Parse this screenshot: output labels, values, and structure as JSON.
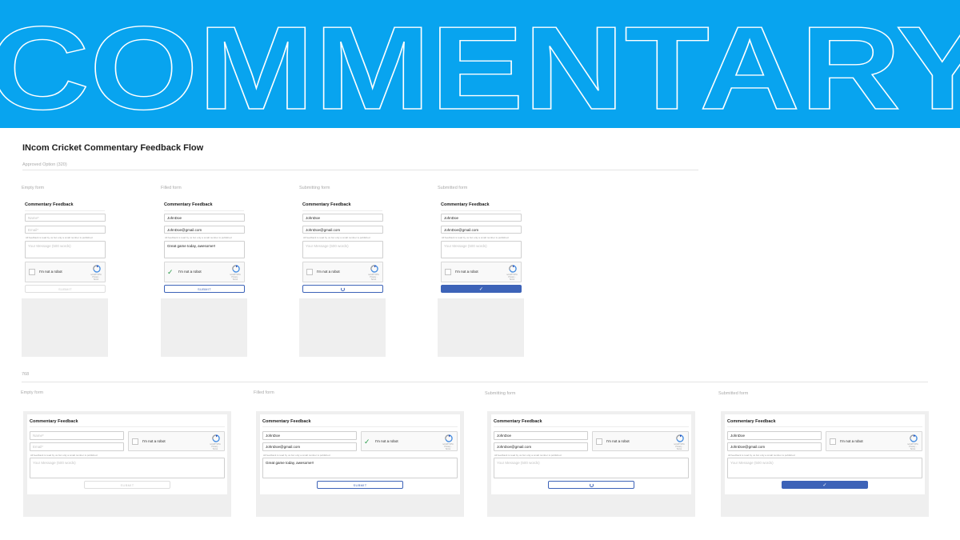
{
  "banner": {
    "text": "COMMENTARY",
    "color": "#08a4ef"
  },
  "page_title": "INcom Cricket Commentary Feedback Flow",
  "mobile_section": {
    "label": "Approved Option (320)",
    "frames": [
      {
        "label": "Empty form",
        "state": "empty"
      },
      {
        "label": "Filled form",
        "state": "filled"
      },
      {
        "label": "Submitting form",
        "state": "submitting"
      },
      {
        "label": "Submitted form",
        "state": "submitted"
      }
    ]
  },
  "tablet_section": {
    "label": "768",
    "frames": [
      {
        "label": "Empty form",
        "state": "empty"
      },
      {
        "label": "Filled form",
        "state": "filled"
      },
      {
        "label": "Submitting form",
        "state": "submitting"
      },
      {
        "label": "Submitted form",
        "state": "submitted"
      }
    ]
  },
  "form": {
    "title": "Commentary Feedback",
    "name_placeholder": "Name*",
    "email_placeholder": "Email*",
    "message_placeholder": "Your Message (500 words)",
    "name_value": "JohnDoe",
    "email_value": "JohnDoe@gmail.com",
    "message_value": "Great game today, awesome!!",
    "note": "All feedback is read by us but only a small number is published",
    "captcha_label": "I'm not a robot",
    "captcha_brand": "reCAPTCHA",
    "captcha_links": "Privacy - Terms",
    "submit_label": "SUBMIT"
  },
  "colors": {
    "accent": "#3d63b8",
    "captcha_check": "#2b9a4a",
    "placeholder_grey": "#efefef"
  }
}
